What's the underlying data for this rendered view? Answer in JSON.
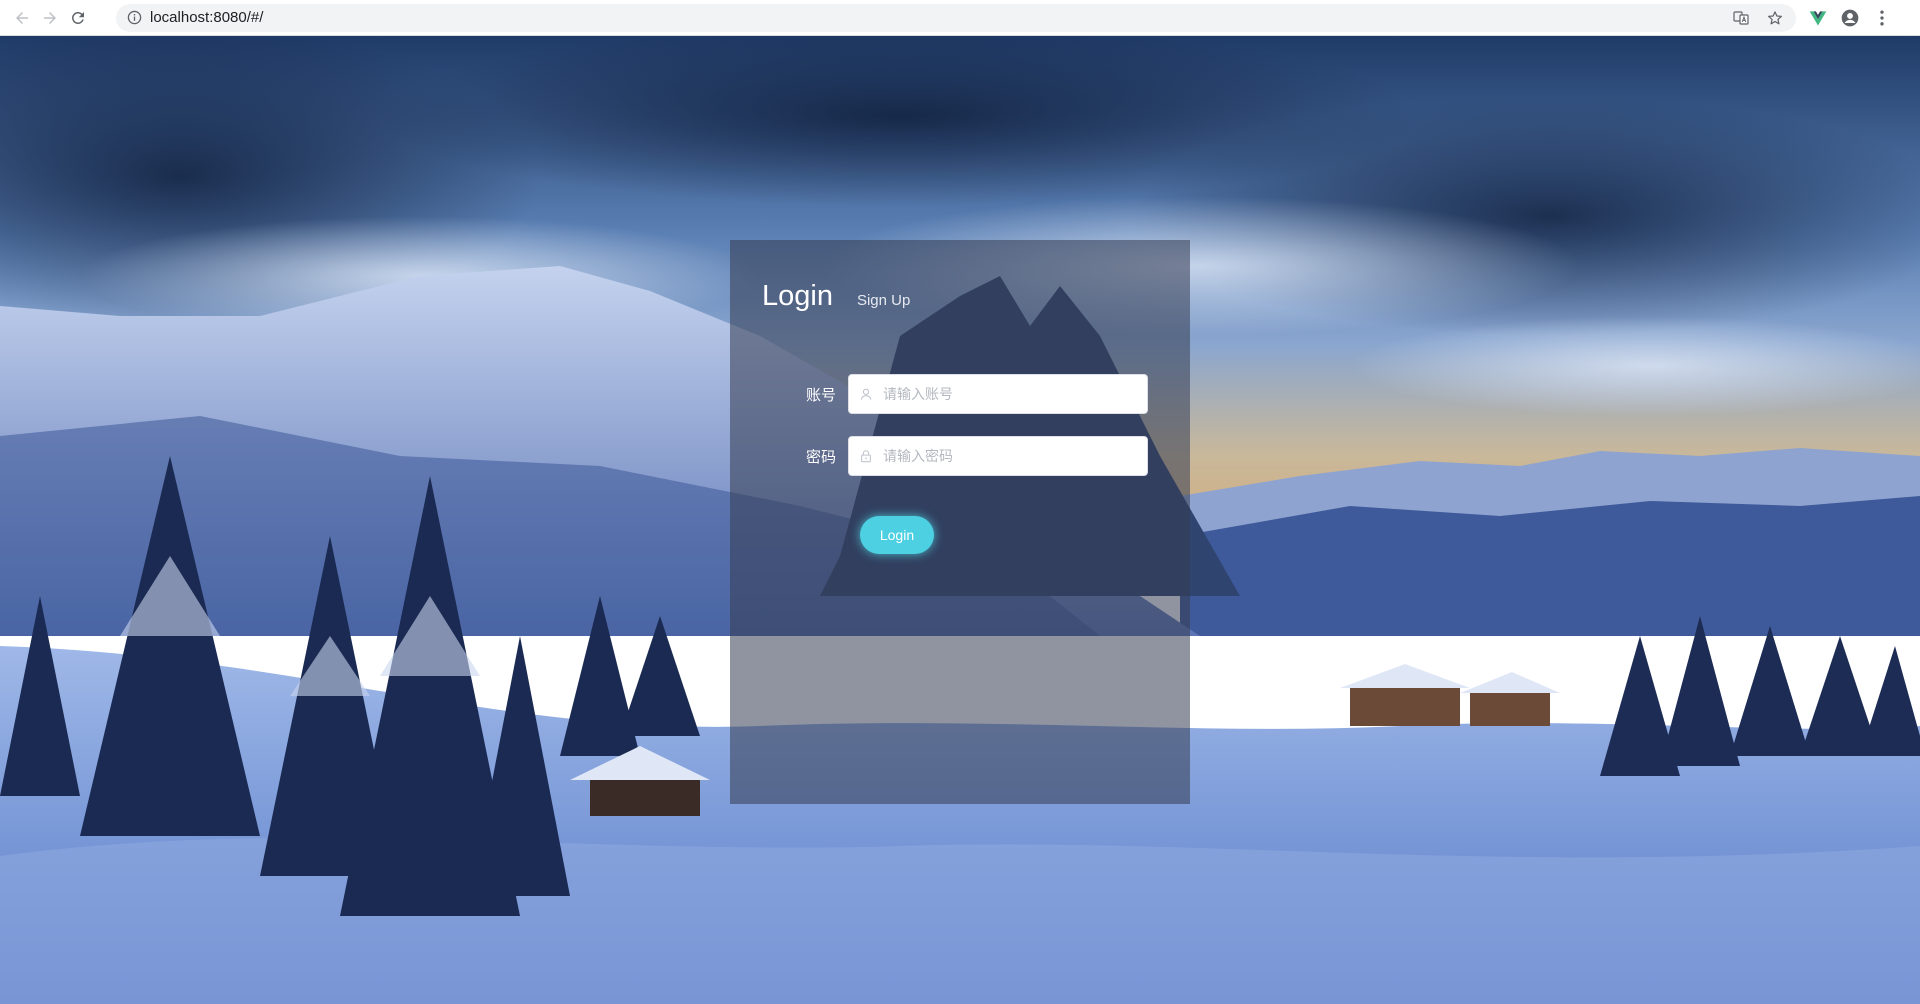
{
  "browser": {
    "url": "localhost:8080/#/",
    "back_icon": "back-arrow-icon",
    "forward_icon": "forward-arrow-icon",
    "reload_icon": "reload-icon",
    "info_icon": "info-icon",
    "translate_icon": "translate-icon",
    "bookmark_icon": "star-icon",
    "extension_icon": "vue-devtools-icon",
    "profile_icon": "account-icon",
    "menu_icon": "kebab-menu-icon"
  },
  "login": {
    "title": "Login",
    "signup_tab": "Sign Up",
    "account_label": "账号",
    "account_placeholder": "请输入账号",
    "account_value": "",
    "password_label": "密码",
    "password_placeholder": "请输入密码",
    "password_value": "",
    "submit_label": "Login"
  },
  "colors": {
    "accent": "#4dd0e1",
    "panel": "rgba(52,60,82,0.55)"
  }
}
